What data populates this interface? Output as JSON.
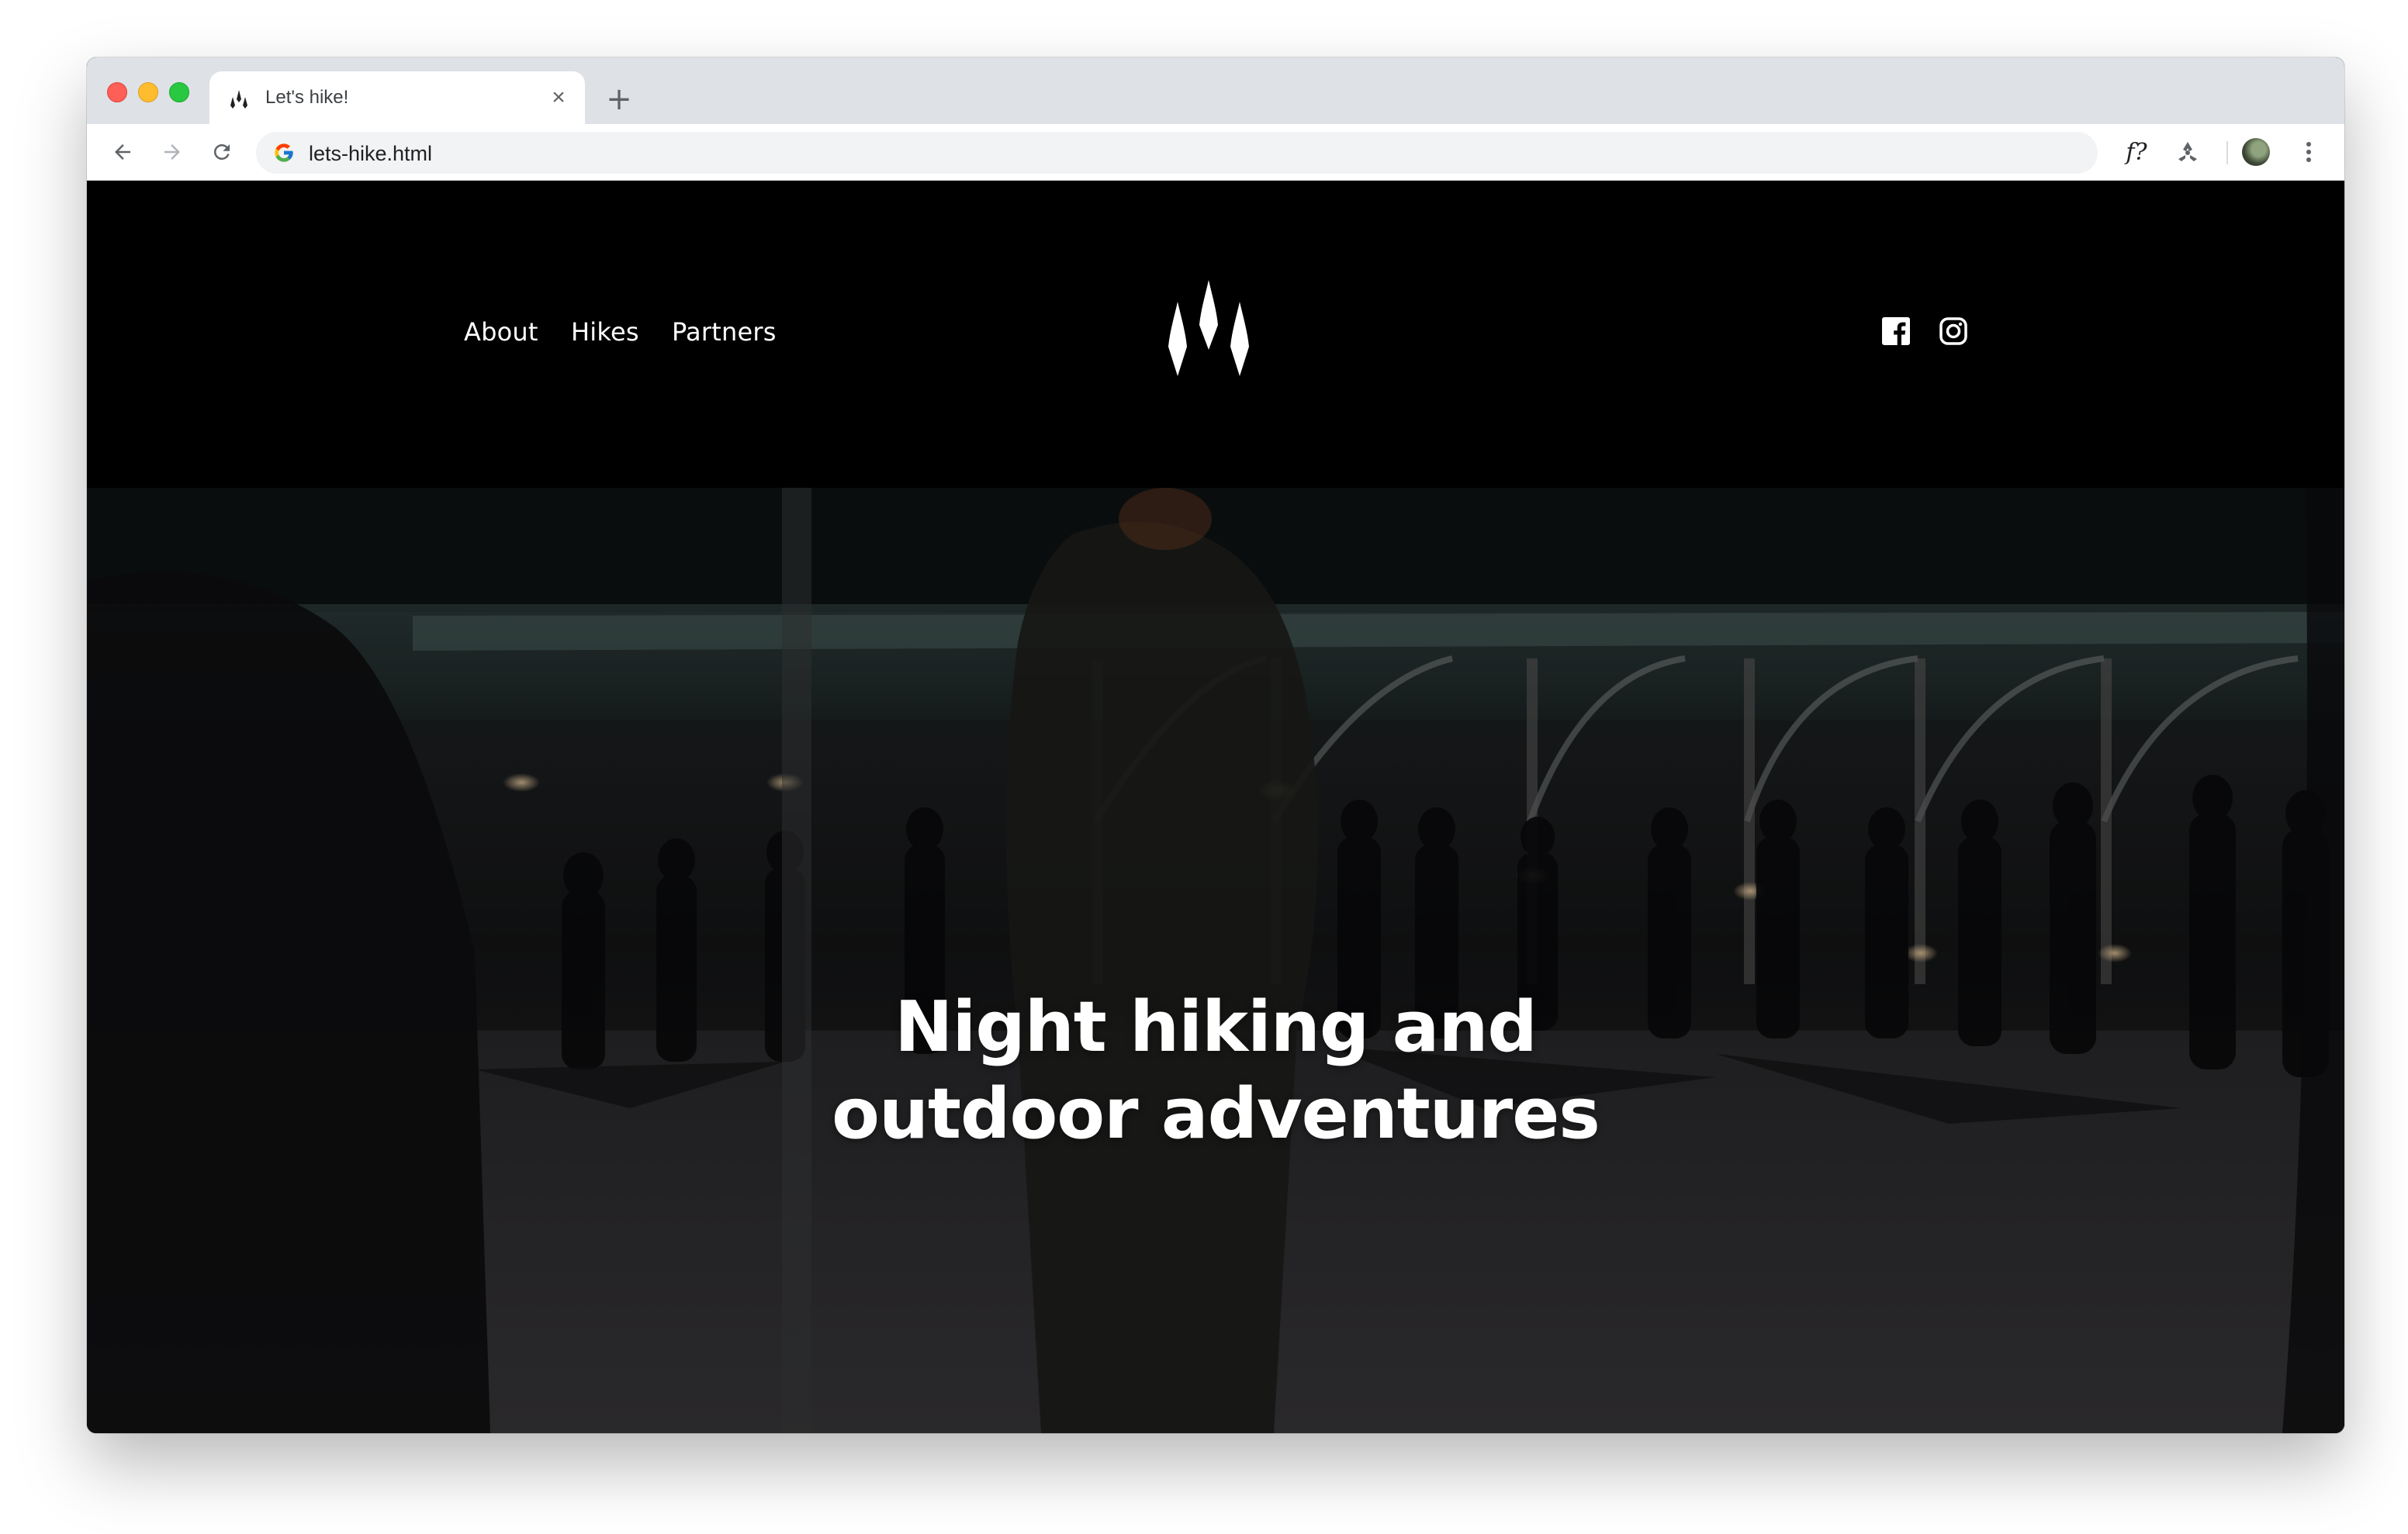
{
  "browser": {
    "tab_title": "Let's hike!",
    "tab_close_glyph": "×",
    "new_tab_glyph": "+",
    "url": "lets-hike.html",
    "extension_fx_label": "f?",
    "icons": [
      "back-arrow-icon",
      "forward-arrow-icon",
      "reload-icon",
      "google-icon",
      "biohazard-extension-icon",
      "profile-avatar",
      "kebab-menu-icon"
    ]
  },
  "site": {
    "nav": [
      {
        "label": "About"
      },
      {
        "label": "Hikes"
      },
      {
        "label": "Partners"
      }
    ],
    "logo_icon": "three-flames-logo",
    "social_icons": [
      "facebook-icon",
      "instagram-icon"
    ],
    "hero": {
      "title_line1": "Night hiking and",
      "title_line2": "outdoor adventures"
    }
  },
  "colors": {
    "page_background": "#000000",
    "text": "#ffffff",
    "chrome_tabstrip": "#dee1e6",
    "omnibox": "#f1f3f4"
  }
}
